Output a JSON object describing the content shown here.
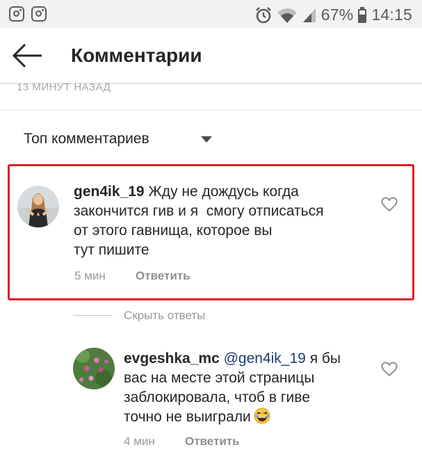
{
  "status_bar": {
    "left_icons": [
      "instagram-icon",
      "instagram-icon"
    ],
    "right_icons": [
      "alarm-icon",
      "wifi-icon",
      "signal-icon",
      "battery-icon"
    ],
    "battery": "67%",
    "time": "14:15"
  },
  "header": {
    "back_icon": "arrow-left-icon",
    "title": "Комментарии"
  },
  "post": {
    "timestamp": "13 МИНУТ НАЗАД"
  },
  "sort": {
    "label": "Топ комментариев",
    "icon": "caret-down-icon"
  },
  "colors": {
    "highlight": "#e01b24",
    "text": "#262626",
    "muted": "#999999",
    "mention": "#1d3b72",
    "status_bar_bg": "#f2f2f2"
  },
  "comments": [
    {
      "username": "gen4ik_19",
      "lines": [
        "Жду не дождусь когда",
        "закончится гив и я  смогу отписаться",
        "от этого гавнища, которое вы",
        "тут пишите"
      ],
      "time": "5 мин",
      "reply_label": "Ответить",
      "highlighted": true
    }
  ],
  "replies_toggle": "Скрыть ответы",
  "replies": [
    {
      "username": "evgeshka_mc",
      "mention": "@gen4ik_19",
      "line1_rest": "я бы",
      "lines": [
        "вас на месте этой страницы",
        "заблокировала, чтоб в гиве",
        "точно не выиграли"
      ],
      "emoji": "laughing-emoji",
      "time": "4 мин",
      "reply_label": "Ответить"
    }
  ]
}
